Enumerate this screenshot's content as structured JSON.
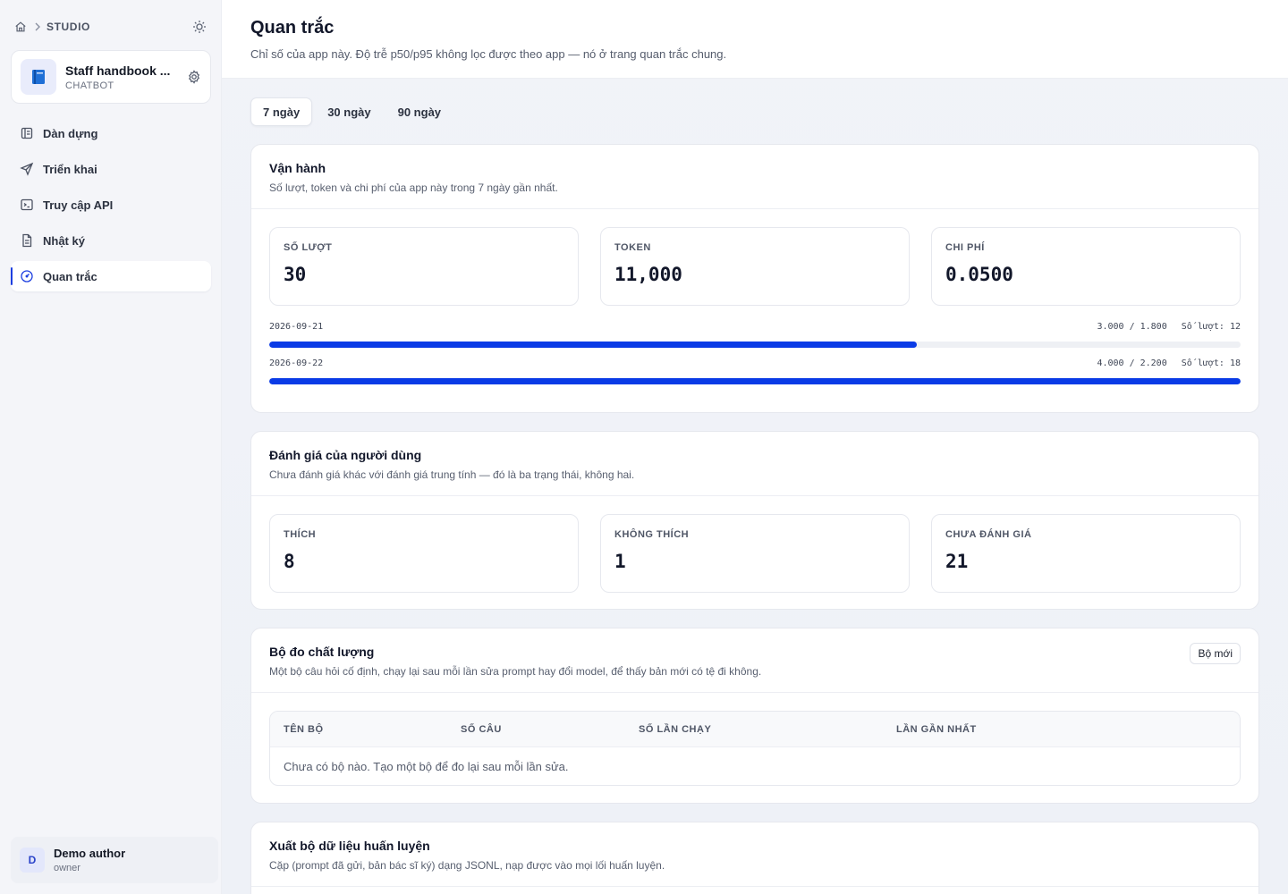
{
  "sidebar": {
    "breadcrumb": {
      "section": "STUDIO"
    },
    "app": {
      "icon": "book-icon",
      "name": "Staff handbook ...",
      "kind": "CHATBOT"
    },
    "nav": [
      {
        "label": "Dàn dựng",
        "icon": "layout-icon",
        "active": false
      },
      {
        "label": "Triển khai",
        "icon": "send-icon",
        "active": false
      },
      {
        "label": "Truy cập API",
        "icon": "terminal-icon",
        "active": false
      },
      {
        "label": "Nhật ký",
        "icon": "document-icon",
        "active": false
      },
      {
        "label": "Quan trắc",
        "icon": "gauge-icon",
        "active": true
      }
    ],
    "user": {
      "initial": "D",
      "name": "Demo author",
      "role": "owner"
    }
  },
  "header": {
    "title": "Quan trắc",
    "subtitle": "Chỉ số của app này. Độ trễ p50/p95 không lọc được theo app — nó ở trang quan trắc chung."
  },
  "range_tabs": [
    {
      "label": "7 ngày",
      "active": true
    },
    {
      "label": "30 ngày",
      "active": false
    },
    {
      "label": "90 ngày",
      "active": false
    }
  ],
  "operations": {
    "title": "Vận hành",
    "subtitle": "Số lượt, token và chi phí của app này trong 7 ngày gần nhất.",
    "stats": [
      {
        "label": "SỐ LƯỢT",
        "value": "30"
      },
      {
        "label": "TOKEN",
        "value": "11,000"
      },
      {
        "label": "CHI PHÍ",
        "value": "0.0500"
      }
    ],
    "daily": [
      {
        "date": "2026-09-21",
        "tokens": "3.000 / 1.800",
        "runs_text": "Số lượt: 12",
        "runs": 12
      },
      {
        "date": "2026-09-22",
        "tokens": "4.000 / 2.200",
        "runs_text": "Số lượt: 18",
        "runs": 18
      }
    ],
    "bar_max": 18
  },
  "feedback": {
    "title": "Đánh giá của người dùng",
    "subtitle": "Chưa đánh giá khác với đánh giá trung tính — đó là ba trạng thái, không hai.",
    "stats": [
      {
        "label": "THÍCH",
        "value": "8"
      },
      {
        "label": "KHÔNG THÍCH",
        "value": "1"
      },
      {
        "label": "CHƯA ĐÁNH GIÁ",
        "value": "21"
      }
    ]
  },
  "quality": {
    "title": "Bộ đo chất lượng",
    "subtitle": "Một bộ câu hỏi cố định, chạy lại sau mỗi lần sửa prompt hay đổi model, để thấy bản mới có tệ đi không.",
    "new_button": "Bộ mới",
    "columns": [
      "TÊN BỘ",
      "SỐ CÂU",
      "SỐ LẦN CHẠY",
      "LẦN GẦN NHẤT"
    ],
    "empty": "Chưa có bộ nào. Tạo một bộ để đo lại sau mỗi lần sửa."
  },
  "export": {
    "title": "Xuất bộ dữ liệu huấn luyện",
    "subtitle": "Cặp (prompt đã gửi, bản bác sĩ ký) dạng JSONL, nạp được vào mọi lối huấn luyện."
  },
  "colors": {
    "accent": "#0a3be6",
    "active_marker": "#1d3fe0"
  }
}
